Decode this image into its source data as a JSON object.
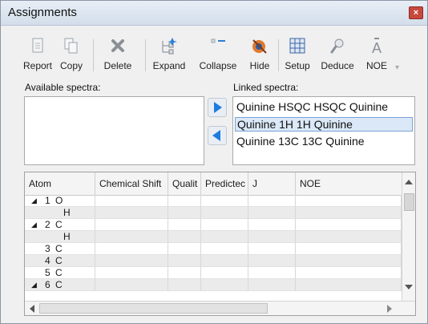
{
  "window": {
    "title": "Assignments"
  },
  "toolbar": {
    "items": [
      {
        "label": "Report",
        "icon": "report-icon"
      },
      {
        "label": "Copy",
        "icon": "copy-icon"
      },
      {
        "label": "Delete",
        "icon": "delete-icon"
      },
      {
        "label": "Expand",
        "icon": "expand-icon"
      },
      {
        "label": "Collapse",
        "icon": "collapse-icon"
      },
      {
        "label": "Hide",
        "icon": "hide-icon"
      },
      {
        "label": "Setup",
        "icon": "setup-icon"
      },
      {
        "label": "Deduce",
        "icon": "deduce-icon"
      },
      {
        "label": "NOE",
        "icon": "noe-icon"
      }
    ],
    "overflow": "▾"
  },
  "available": {
    "label": "Available spectra:"
  },
  "linked": {
    "label": "Linked spectra:",
    "items": [
      {
        "text": "Quinine HSQC HSQC Quinine",
        "selected": false
      },
      {
        "text": "Quinine 1H 1H Quinine",
        "selected": true
      },
      {
        "text": "Quinine 13C 13C Quinine",
        "selected": false
      }
    ]
  },
  "colors": {
    "arrow": "#1e7be0",
    "selection": "#dbe8f7",
    "alt_row": "#ebebeb"
  },
  "table": {
    "columns": [
      "Atom",
      "Chemical Shift",
      "Qualit",
      "Predictec",
      "J",
      "NOE"
    ],
    "rows": [
      {
        "toggle": "◢",
        "index": "1",
        "element": "O",
        "indent": 0
      },
      {
        "toggle": "",
        "index": "",
        "element": "H",
        "indent": 1
      },
      {
        "toggle": "◢",
        "index": "2",
        "element": "C",
        "indent": 0
      },
      {
        "toggle": "",
        "index": "",
        "element": "H",
        "indent": 1
      },
      {
        "toggle": "",
        "index": "3",
        "element": "C",
        "indent": 0
      },
      {
        "toggle": "",
        "index": "4",
        "element": "C",
        "indent": 0
      },
      {
        "toggle": "",
        "index": "5",
        "element": "C",
        "indent": 0
      },
      {
        "toggle": "◢",
        "index": "6",
        "element": "C",
        "indent": 0
      }
    ]
  }
}
